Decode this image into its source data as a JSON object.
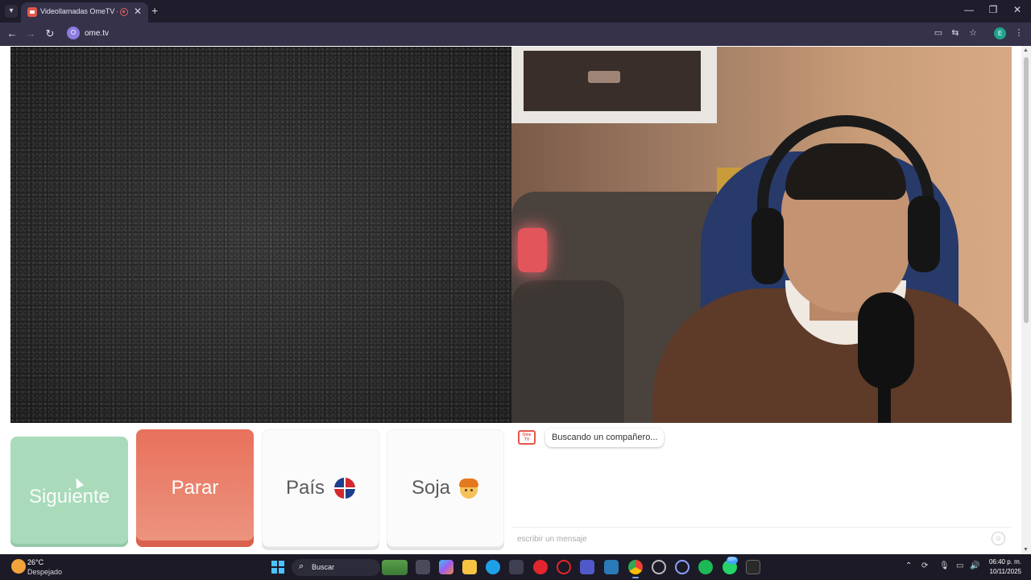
{
  "browser": {
    "tab_title": "Videollamadas OmeTV — A",
    "tab_close": "✕",
    "new_tab": "+",
    "url": "ome.tv",
    "site_icon": "O",
    "profile_initial": "E",
    "icons": [
      "tab-list-icon",
      "back-icon",
      "forward-icon",
      "reload-icon",
      "cast-icon",
      "translate-icon",
      "bookmark-star-icon",
      "menu-dots-icon"
    ],
    "window_controls": {
      "minimize": "—",
      "restore": "❐",
      "close": "✕"
    }
  },
  "app": {
    "buttons": {
      "next": "Siguiente",
      "stop": "Parar",
      "country": "País",
      "gender": "Soja"
    },
    "chat": {
      "logo_text": "Ome TV",
      "status_message": "Buscando un compañero...",
      "input_placeholder": "escribir un mensaje"
    }
  },
  "taskbar": {
    "weather_temp": "26°C",
    "weather_desc": "Despejado",
    "search_label": "Buscar",
    "badge": "99+",
    "time": "06:40 p. m.",
    "date": "10/11/2025"
  },
  "colors": {
    "next_button": "#a9dbbb",
    "stop_button": "#e8715c",
    "browser_frame": "#35324a",
    "taskbar": "#1b1a26"
  }
}
